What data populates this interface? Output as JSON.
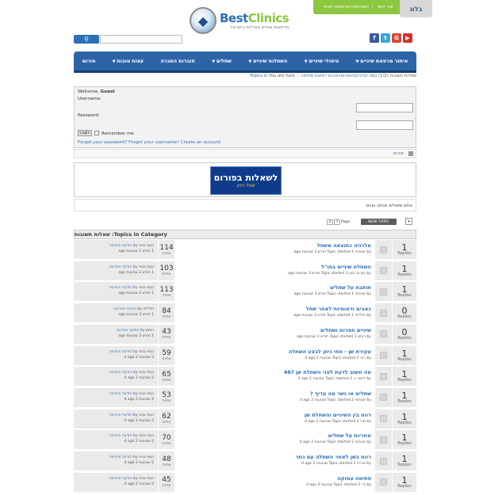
{
  "header": {
    "blog_label": "בלוג",
    "top_link_contact": "צור קשר",
    "top_link_clinics": "הצטרפות מרפאות לאתר",
    "logo_name_a": "Best",
    "logo_name_b": "Clinics",
    "logo_sub": "מרפאות שיניים מובילות בישראל",
    "social": [
      {
        "icon": "youtube-icon",
        "glyph": "▶",
        "color": "#d9302c"
      },
      {
        "icon": "google-icon",
        "glyph": "G",
        "color": "#d64b36"
      },
      {
        "icon": "twitter-icon",
        "glyph": "t",
        "color": "#3ea6dd"
      },
      {
        "icon": "facebook-icon",
        "glyph": "f",
        "color": "#3b5a9a"
      }
    ]
  },
  "nav": {
    "items": [
      "איתור מרפאת שיניים",
      "טיפולי שיניים",
      "השתלות שיניים",
      "שתלים",
      "חוברות הסברה",
      "עצות טובות",
      "פורום"
    ],
    "has_caret": [
      true,
      true,
      true,
      true,
      false,
      true,
      false
    ]
  },
  "breadcrumb": {
    "prefix": "You are here",
    "trail": "בסט קליניקס»פורום»פורום רפואת שיניים» :: Topics in",
    "current": "שאלות תשובות (1/2)"
  },
  "login": {
    "welcome": "Welcome,",
    "guest": "Guest",
    "username_label": "Username:",
    "password_label": "Password:",
    "login_btn": "Login",
    "remember": "Remember me",
    "forgot_pw": "Forgot your password?",
    "forgot_user": "Forgot your username?",
    "create": "Create an account"
  },
  "forums_link": "פורום",
  "banner": {
    "title": "לשאלות בפורום",
    "sub": "שאל ניתן"
  },
  "description": "אתם שואלים אנחנו עונים",
  "toolbar": {
    "new_topic": "NEW TOPIC",
    "pages": [
      "2",
      "1",
      "Page"
    ],
    "expand": "▾"
  },
  "category_header": "Topics in Category: שאלות תשובות",
  "labels": {
    "replies": "Replies",
    "views": "צפיות",
    "by": "by",
    "topic_started": "Topic started",
    "ago": "ago",
    "last_post": "הודעה אחרונה"
  },
  "topics": [
    {
      "title": "אלרגיה כתוצאה משתל",
      "replies": "1",
      "views": "114",
      "started": "1 חודש 3 שבועות",
      "author": "אנונימי",
      "last_by": "נעמי גבאי",
      "last_time": "1 חודש 1 שבועות"
    },
    {
      "title": "השתלת שיניים בחו\"ל",
      "replies": "1",
      "views": "103",
      "started": "1 חודש 3 שבועות",
      "author": "נקרוב נסע",
      "last_by": "נעמי גבאי",
      "last_time": "1 חודש 2 שבועות"
    },
    {
      "title": "תותבת על שתלים",
      "replies": "1",
      "views": "113",
      "started": "1 חודש 3 שבועות",
      "author": "אנונימי",
      "last_by": "נעמי גבאי",
      "last_time": "1 חודש 2 שבועות"
    },
    {
      "title": "כאבים ודמומיות לאחר שתל",
      "replies": "0",
      "views": "84",
      "started": "1 חודש 3 שבועות",
      "author": "חולילה",
      "last_by": "חולילה",
      "last_time": "1 חודש 3 שבועות"
    },
    {
      "title": "שיניים חסרות ושתלים",
      "replies": "0",
      "views": "43",
      "started": "1 חודש 3 שבועות",
      "author": "רותם",
      "last_by": "רותם",
      "last_time": "1 חודש 3 שבועות"
    },
    {
      "title": "עקירת שן - מתי ניתן לבצע השתלה",
      "replies": "1",
      "views": "59",
      "started": "2 שבועות 2 d",
      "author": "רוני",
      "last_by": "נעמי גבאי",
      "last_time": "2 שבועות 2 d"
    },
    {
      "title": "מה חשוב לדעת לפני השתלת שן ?46",
      "replies": "1",
      "views": "65",
      "started": "2 שבועות 2 d",
      "author": "ליאור נ.",
      "last_by": "נעמי גבאי",
      "last_time": "2 שבועות 2 d"
    },
    {
      "title": "שתלים או גשר מה עדיף ?",
      "replies": "1",
      "views": "53",
      "started": "2 שבועות 2 d",
      "author": "אנונימי",
      "last_by": "נעמי גבאי",
      "last_time": "2 שבועות 2 d"
    },
    {
      "title": "רווח בין השיניים והשתלת שן",
      "replies": "1",
      "views": "62",
      "started": "2 שבועות 2 d",
      "author": "מור",
      "last_by": "נעמי גבאי",
      "last_time": "2 שבועות 2 d"
    },
    {
      "title": "אחריות על שתלים",
      "replies": "1",
      "views": "70",
      "started": "2 שבועות 2 d",
      "author": "אנונימי",
      "last_by": "נעמי גבאי",
      "last_time": "2 שבועות 2 d"
    },
    {
      "title": "רווח בשן לאחר השתלה עם כתר",
      "replies": "1",
      "views": "48",
      "started": "2 שבועות 2 d",
      "author": "אורית",
      "last_by": "נעמי גבאי",
      "last_time": "2 שבועות 2 d"
    },
    {
      "title": "סתימה עמוקה",
      "replies": "1",
      "views": "45",
      "started": "2 שבועות 4 d",
      "author": "צ'י",
      "last_by": "נעמי גבאי",
      "last_time": "2 שבועות 2 d"
    }
  ]
}
